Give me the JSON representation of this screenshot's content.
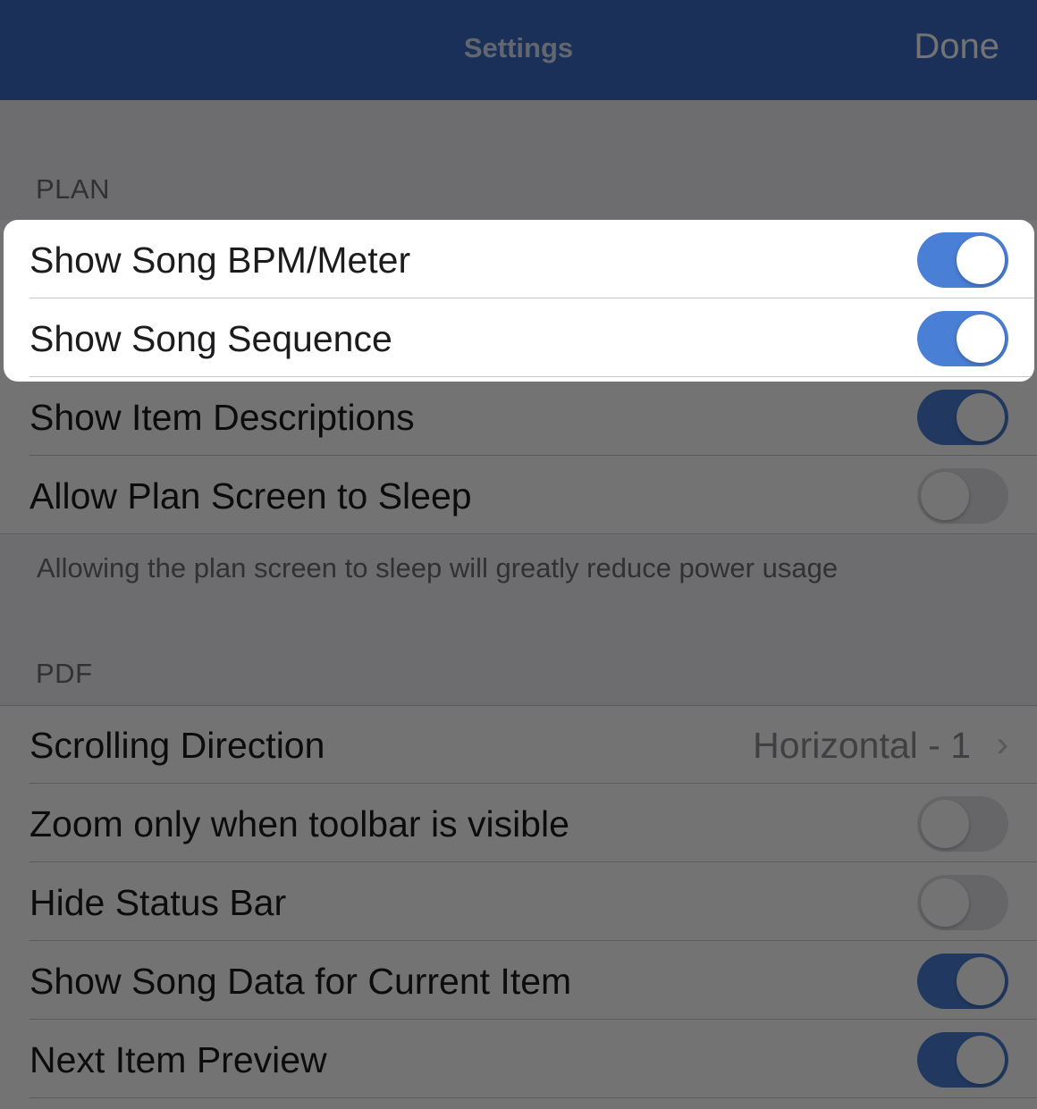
{
  "header": {
    "title": "Settings",
    "done_label": "Done"
  },
  "plan_section": {
    "label": "PLAN",
    "rows": [
      {
        "label": "Show Song BPM/Meter",
        "toggle": true
      },
      {
        "label": "Show Song Sequence",
        "toggle": true
      },
      {
        "label": "Show Item Descriptions",
        "toggle": true
      },
      {
        "label": "Allow Plan Screen to Sleep",
        "toggle": false
      }
    ],
    "footnote": "Allowing the plan screen to sleep will greatly reduce power usage"
  },
  "pdf_section": {
    "label": "PDF",
    "scrolling_direction": {
      "label": "Scrolling Direction",
      "value": "Horizontal - 1"
    },
    "rows": [
      {
        "label": "Zoom only when toolbar is visible",
        "toggle": false
      },
      {
        "label": "Hide Status Bar",
        "toggle": false
      },
      {
        "label": "Show Song Data for Current Item",
        "toggle": true
      },
      {
        "label": "Next Item Preview",
        "toggle": true
      }
    ]
  },
  "colors": {
    "header": "#3a6cc4",
    "toggle_on": "#4a7fd6",
    "toggle_off": "#e3e3e8",
    "background": "#f2f2f7"
  }
}
